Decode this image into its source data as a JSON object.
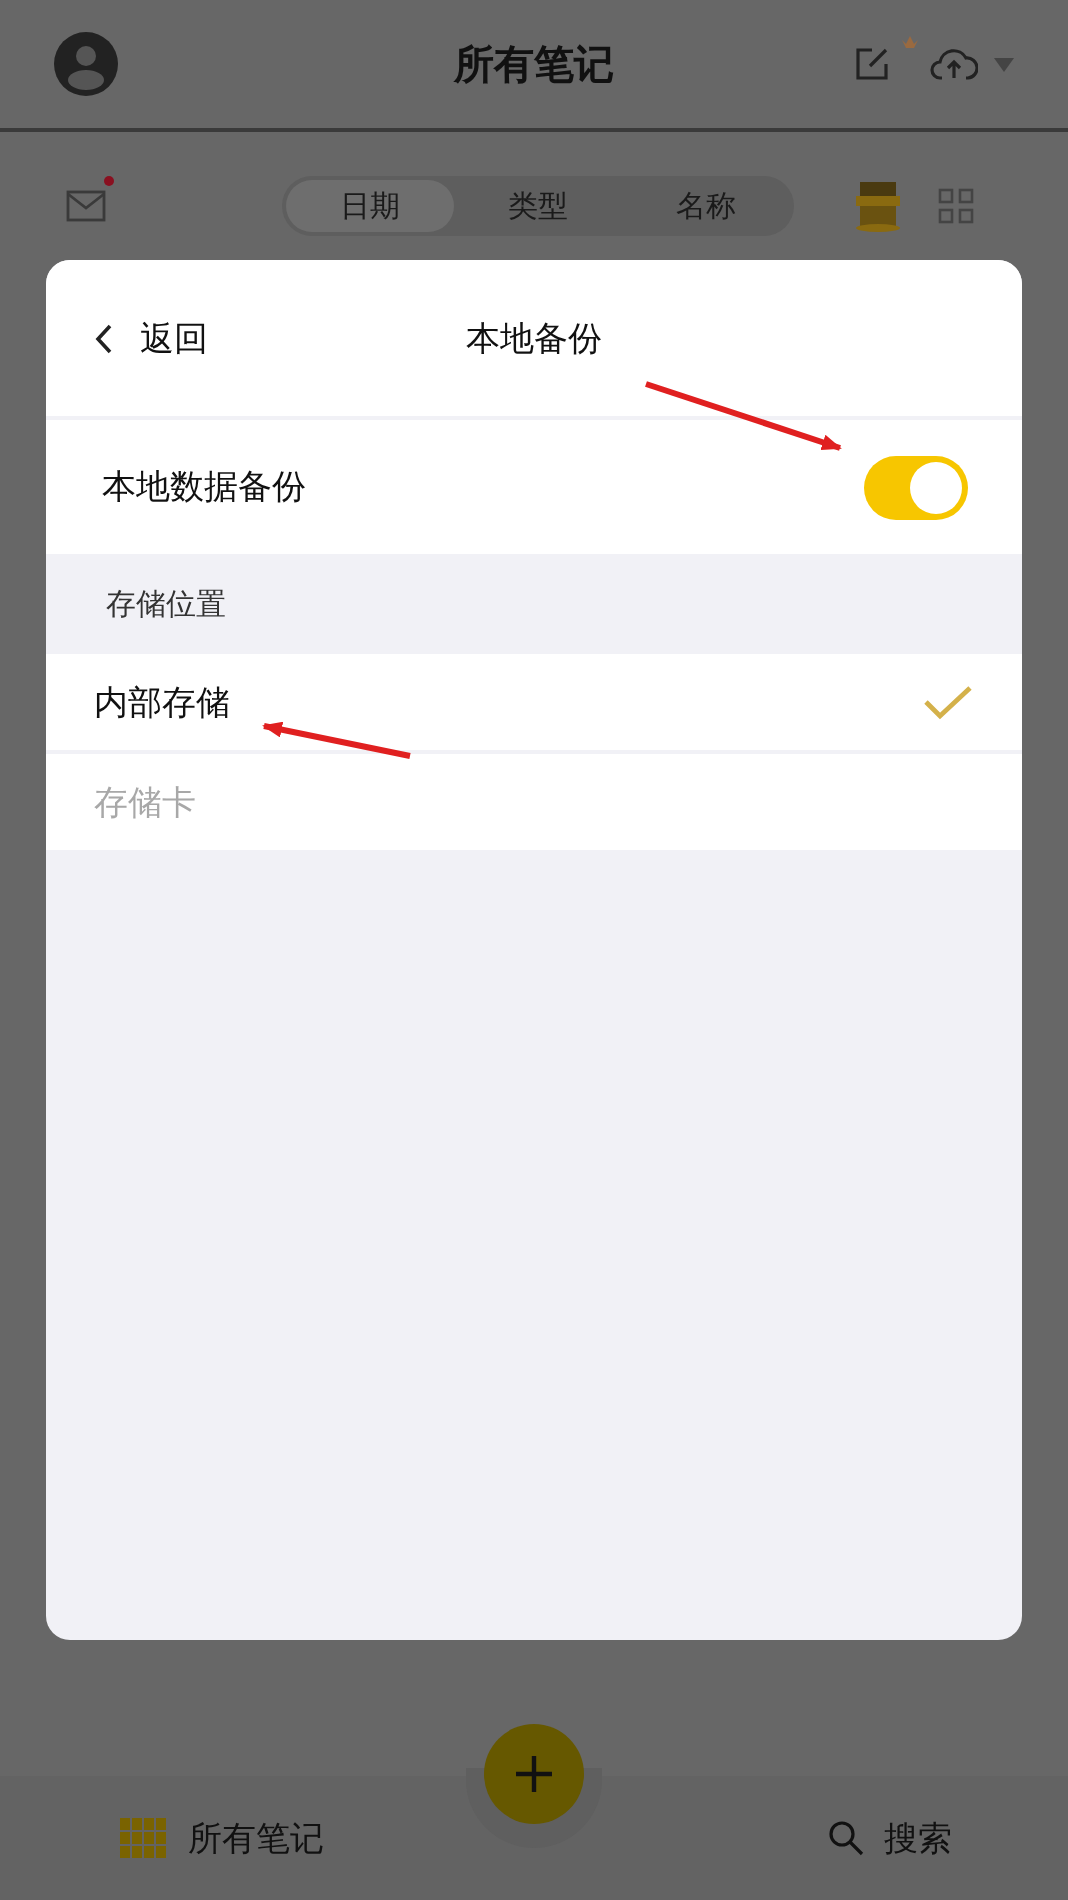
{
  "header": {
    "title": "所有笔记"
  },
  "mail": {
    "unread": true
  },
  "sort_tabs": [
    {
      "label": "日期",
      "selected": true
    },
    {
      "label": "类型",
      "selected": false
    },
    {
      "label": "名称",
      "selected": false
    }
  ],
  "dialog": {
    "back": "返回",
    "title": "本地备份",
    "toggle": {
      "label": "本地数据备份",
      "on": true
    },
    "section": "存储位置",
    "options": [
      {
        "label": "内部存储",
        "selected": true,
        "disabled": false
      },
      {
        "label": "存储卡",
        "selected": false,
        "disabled": true
      }
    ]
  },
  "bottom_nav": [
    {
      "label": "所有笔记",
      "kind": "grid"
    },
    {
      "label": "搜索",
      "kind": "search"
    }
  ]
}
